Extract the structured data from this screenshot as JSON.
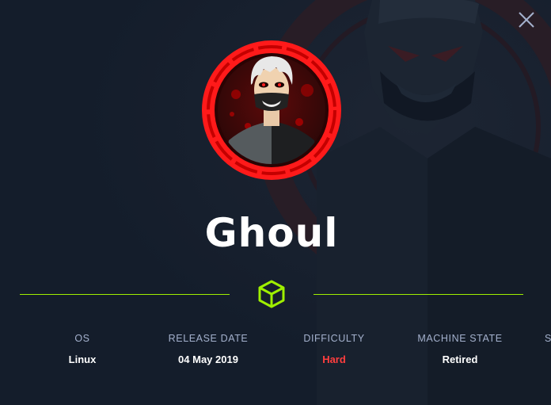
{
  "machine": {
    "name": "Ghoul"
  },
  "stats": [
    {
      "label": "OS",
      "value": "Linux"
    },
    {
      "label": "RELEASE DATE",
      "value": "04 May 2019"
    },
    {
      "label": "DIFFICULTY",
      "value": "Hard"
    },
    {
      "label": "MACHINE STATE",
      "value": "Retired"
    },
    {
      "label": "S",
      "value": ""
    }
  ],
  "icons": {
    "close": "close-icon",
    "cube": "cube-icon",
    "avatar": "ghoul-avatar"
  },
  "colors": {
    "background": "#141d2b",
    "accent": "#9fef00",
    "difficulty_hard": "#ff3e3e",
    "label": "#a4b1cd",
    "avatar_ring": "#ff1a1a"
  }
}
